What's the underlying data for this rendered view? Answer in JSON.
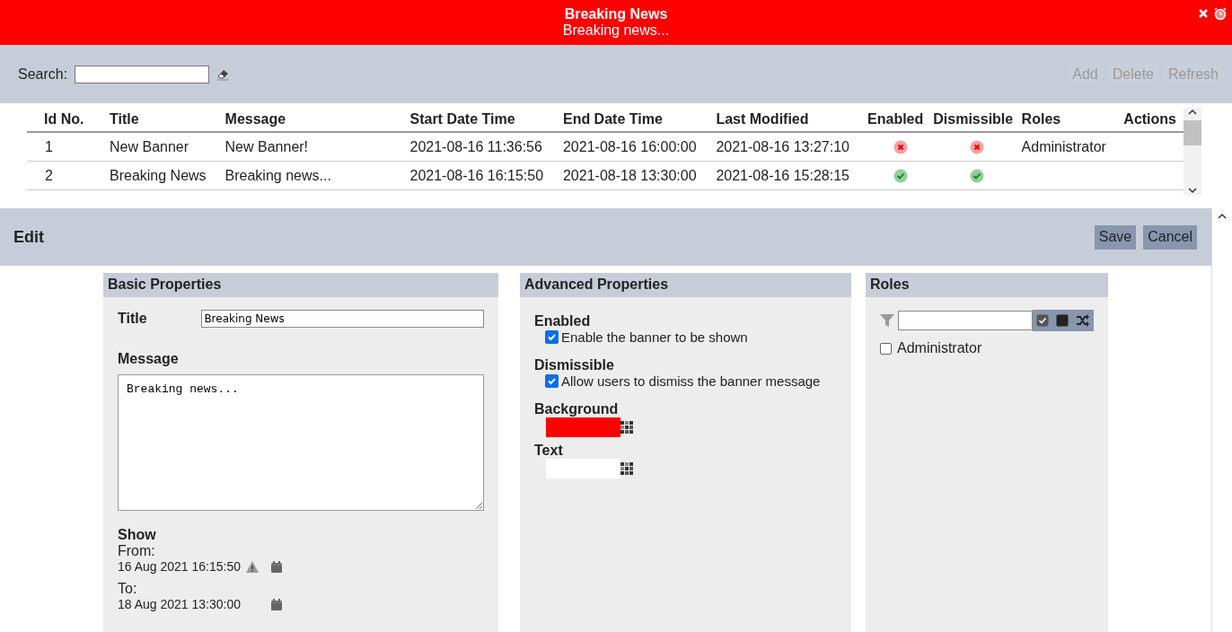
{
  "banner": {
    "title": "Breaking News",
    "message": "Breaking news..."
  },
  "toolbar": {
    "search_label": "Search:",
    "buttons": [
      {
        "label": "Add",
        "disabled": true
      },
      {
        "label": "Delete",
        "disabled": true
      },
      {
        "label": "Refresh",
        "disabled": true
      }
    ]
  },
  "table": {
    "columns": [
      "Id No.",
      "Title",
      "Message",
      "Start Date Time",
      "End Date Time",
      "Last Modified",
      "Enabled",
      "Dismissible",
      "Roles",
      "Actions"
    ],
    "rows": [
      {
        "id": "1",
        "title": "New Banner",
        "message": "New Banner!",
        "start": "2021-08-16 11:36:56",
        "end": "2021-08-16 16:00:00",
        "modified": "2021-08-16 13:27:10",
        "enabled": false,
        "dismissible": false,
        "roles": "Administrator"
      },
      {
        "id": "2",
        "title": "Breaking News",
        "message": "Breaking news...",
        "start": "2021-08-16 16:15:50",
        "end": "2021-08-18 13:30:00",
        "modified": "2021-08-16 15:28:15",
        "enabled": true,
        "dismissible": true
      }
    ]
  },
  "edit": {
    "title": "Edit",
    "buttons": [
      {
        "label": "Save"
      },
      {
        "label": "Cancel"
      }
    ],
    "basic": {
      "heading": "Basic Properties",
      "title_label": "Title",
      "title_value": "Breaking News",
      "message_label": "Message",
      "message_value": "Breaking news...",
      "show_label": "Show",
      "from_label": "From:",
      "from_value": "16 Aug 2021 16:15:50",
      "from_warning": true,
      "to_label": "To:",
      "to_value": "18 Aug 2021 13:30:00",
      "to_warning": false
    },
    "advanced": {
      "heading": "Advanced Properties",
      "options": [
        {
          "label": "Enabled",
          "text": "Enable the banner to be shown",
          "checked": true
        },
        {
          "label": "Dismissible",
          "text": "Allow users to dismiss the banner message",
          "checked": true
        }
      ],
      "colors": [
        {
          "label": "Background",
          "color": "#ff0000"
        },
        {
          "label": "Text",
          "color": "#ffffff"
        }
      ]
    },
    "roles": {
      "heading": "Roles",
      "items": [
        {
          "label": "Administrator",
          "checked": false
        }
      ]
    }
  }
}
